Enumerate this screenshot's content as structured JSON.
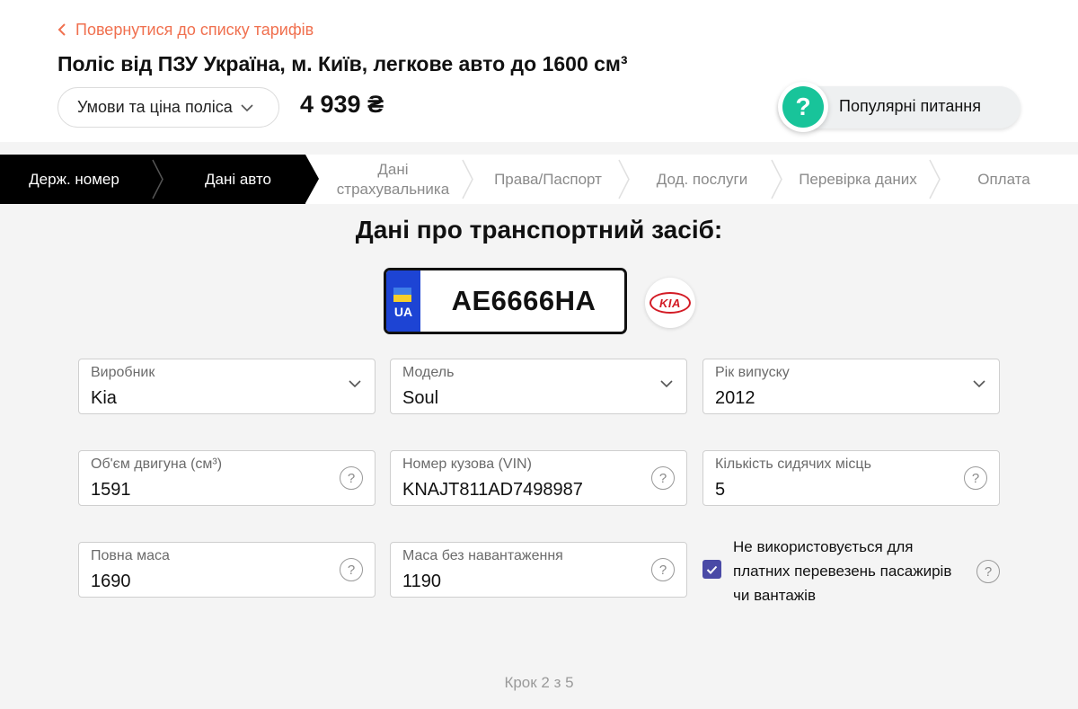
{
  "header": {
    "back_label": "Повернутися до списку тарифів",
    "policy_title": "Поліс від ПЗУ Україна, м. Київ, легкове авто до 1600 см³",
    "terms_button": "Умови та ціна поліса",
    "price": "4 939 ₴",
    "faq_button": "Популярні питання",
    "faq_icon_glyph": "?"
  },
  "steps": [
    {
      "label": "Держ. номер",
      "state": "done"
    },
    {
      "label": "Дані авто",
      "state": "active"
    },
    {
      "label": "Дані страхувальника",
      "state": "todo"
    },
    {
      "label": "Права/Паспорт",
      "state": "todo"
    },
    {
      "label": "Дод. послуги",
      "state": "todo"
    },
    {
      "label": "Перевірка даних",
      "state": "todo"
    },
    {
      "label": "Оплата",
      "state": "todo"
    }
  ],
  "vehicle": {
    "section_title": "Дані про транспортний засіб:",
    "plate_country": "UA",
    "plate_number": "AE6666HA",
    "brand_logo_text": "KIA",
    "brand_icon": "kia-logo-icon"
  },
  "fields": {
    "manufacturer": {
      "label": "Виробник",
      "value": "Kia"
    },
    "model": {
      "label": "Модель",
      "value": "Soul"
    },
    "year": {
      "label": "Рік випуску",
      "value": "2012"
    },
    "engine": {
      "label": "Об'єм двигуна (см³)",
      "value": "1591"
    },
    "vin": {
      "label": "Номер кузова (VIN)",
      "value": "KNAJT811AD7498987"
    },
    "seats": {
      "label": "Кількість сидячих місць",
      "value": "5"
    },
    "gross_mass": {
      "label": "Повна маса",
      "value": "1690"
    },
    "curb_mass": {
      "label": "Маса без навантаження",
      "value": "1190"
    }
  },
  "commercial_use": {
    "label": "Не використовується для платних перевезень пасажирів чи вантажів",
    "checked": true
  },
  "help_glyph": "?",
  "step_counter": "Крок 2 з 5",
  "colors": {
    "accent": "#f0704f",
    "faq_green": "#18c49a",
    "checkbox": "#4a4aa6",
    "plate_blue": "#1d44d4",
    "kia_red": "#d31b25"
  }
}
